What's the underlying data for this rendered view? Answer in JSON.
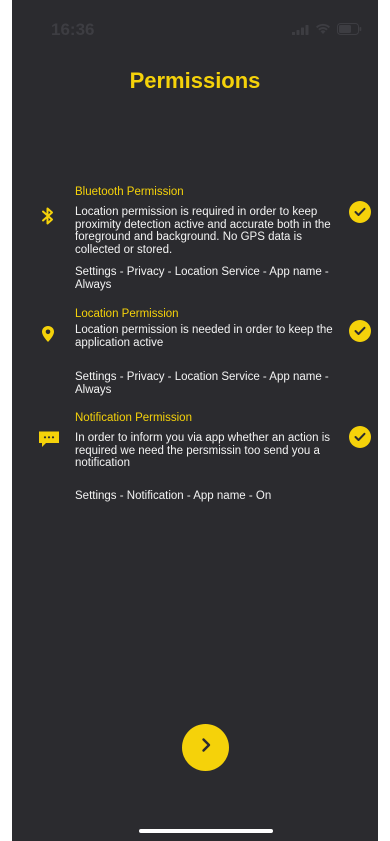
{
  "status_bar": {
    "time": "16:36",
    "icons": [
      "signal-icon",
      "wifi-icon",
      "battery-icon"
    ]
  },
  "title": "Permissions",
  "permissions": [
    {
      "title": "Bluetooth Permission",
      "icon": "bluetooth-icon",
      "description": "Location permission is required in order to keep proximity detection active and accurate both in the foreground and background. No GPS data is collected or stored.",
      "path": "Settings - Privacy - Location Service -  App name - Always",
      "granted": true
    },
    {
      "title": "Location Permission",
      "icon": "location-pin-icon",
      "description": "Location permission is needed in order to keep the application active",
      "path": "Settings - Privacy - Location Service -  App name - Always",
      "granted": true
    },
    {
      "title": "Notification Permission",
      "icon": "chat-bubble-icon",
      "description": "In order to inform you via app  whether an action is required we need the persmissin too send you a notification",
      "path": "Settings - Notification - App name - On",
      "granted": true
    }
  ],
  "next_button": {
    "icon": "chevron-right-icon"
  },
  "colors": {
    "accent": "#f5d20a",
    "background": "#2b2b2f",
    "text": "#f2f2f2"
  }
}
